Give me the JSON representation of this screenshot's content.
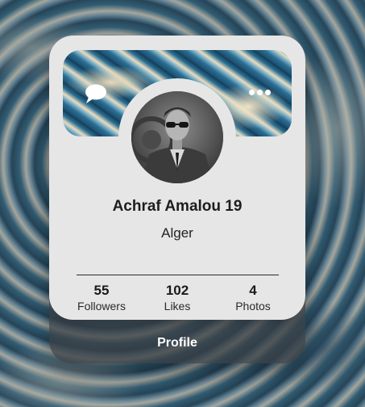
{
  "profile": {
    "name": "Achraf Amalou 19",
    "city": "Alger",
    "avatar_icon": "profile-photo"
  },
  "stats": [
    {
      "value": "55",
      "label": "Followers"
    },
    {
      "value": "102",
      "label": "Likes"
    },
    {
      "value": "4",
      "label": "Photos"
    }
  ],
  "actions": {
    "profile_label": "Profile",
    "chat_icon": "chat-bubble-icon",
    "more_icon": "more-dots-icon"
  },
  "colors": {
    "card": "#e6e6e6",
    "text": "#1d1d1d",
    "button_text": "#ffffff"
  }
}
